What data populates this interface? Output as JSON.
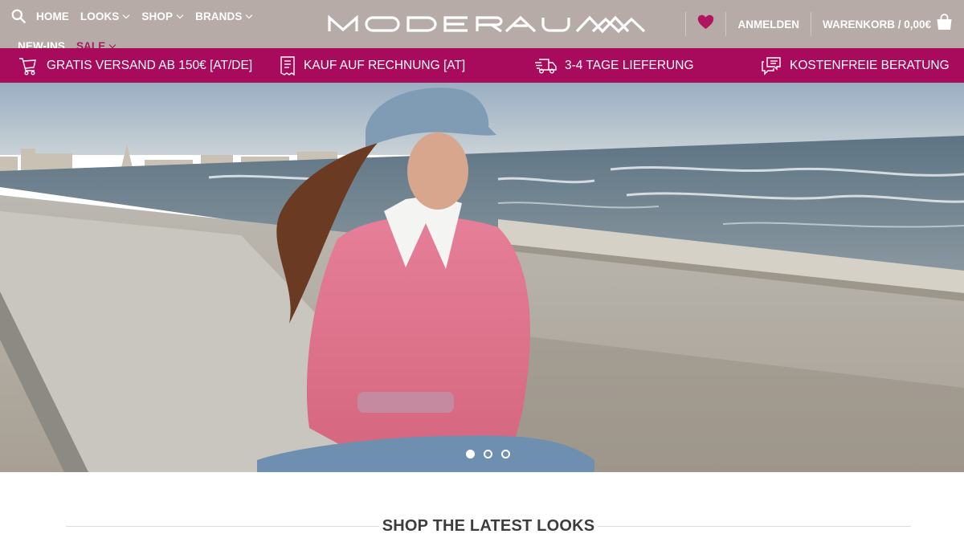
{
  "colors": {
    "header_bg": "#b7aba7",
    "promo_bg": "#a80a5c",
    "sale_text": "#a81b5e",
    "heart": "#b0165e",
    "heading_text": "#3d3d3d"
  },
  "header": {
    "logo_text": "MODERAUM",
    "nav_row1": [
      {
        "label": "HOME",
        "has_dropdown": false
      },
      {
        "label": "LOOKS",
        "has_dropdown": true
      },
      {
        "label": "SHOP",
        "has_dropdown": true
      },
      {
        "label": "BRANDS",
        "has_dropdown": true
      }
    ],
    "nav_row2": [
      {
        "label": "NEW-INS",
        "has_dropdown": false
      },
      {
        "label": "SALE",
        "has_dropdown": true
      }
    ],
    "login_label": "ANMELDEN",
    "cart_label": "WARENKORB / 0,00€",
    "icons": [
      "search-icon",
      "chevron-down-icon",
      "heart-icon",
      "shopping-bag-icon"
    ]
  },
  "promo_bar": {
    "items": [
      {
        "label": "GRATIS VERSAND AB 150€ [AT/DE]",
        "icon": "shopping-cart-icon"
      },
      {
        "label": "KAUF AUF RECHNUNG [AT]",
        "icon": "receipt-icon"
      },
      {
        "label": "3-4 TAGE LIEFERUNG",
        "icon": "delivery-truck-icon"
      },
      {
        "label": "KOSTENFREIE BERATUNG",
        "icon": "chat-bubbles-icon"
      }
    ]
  },
  "hero": {
    "slides_total": 3,
    "active_slide": 1
  },
  "section": {
    "title": "SHOP THE LATEST LOOKS"
  }
}
